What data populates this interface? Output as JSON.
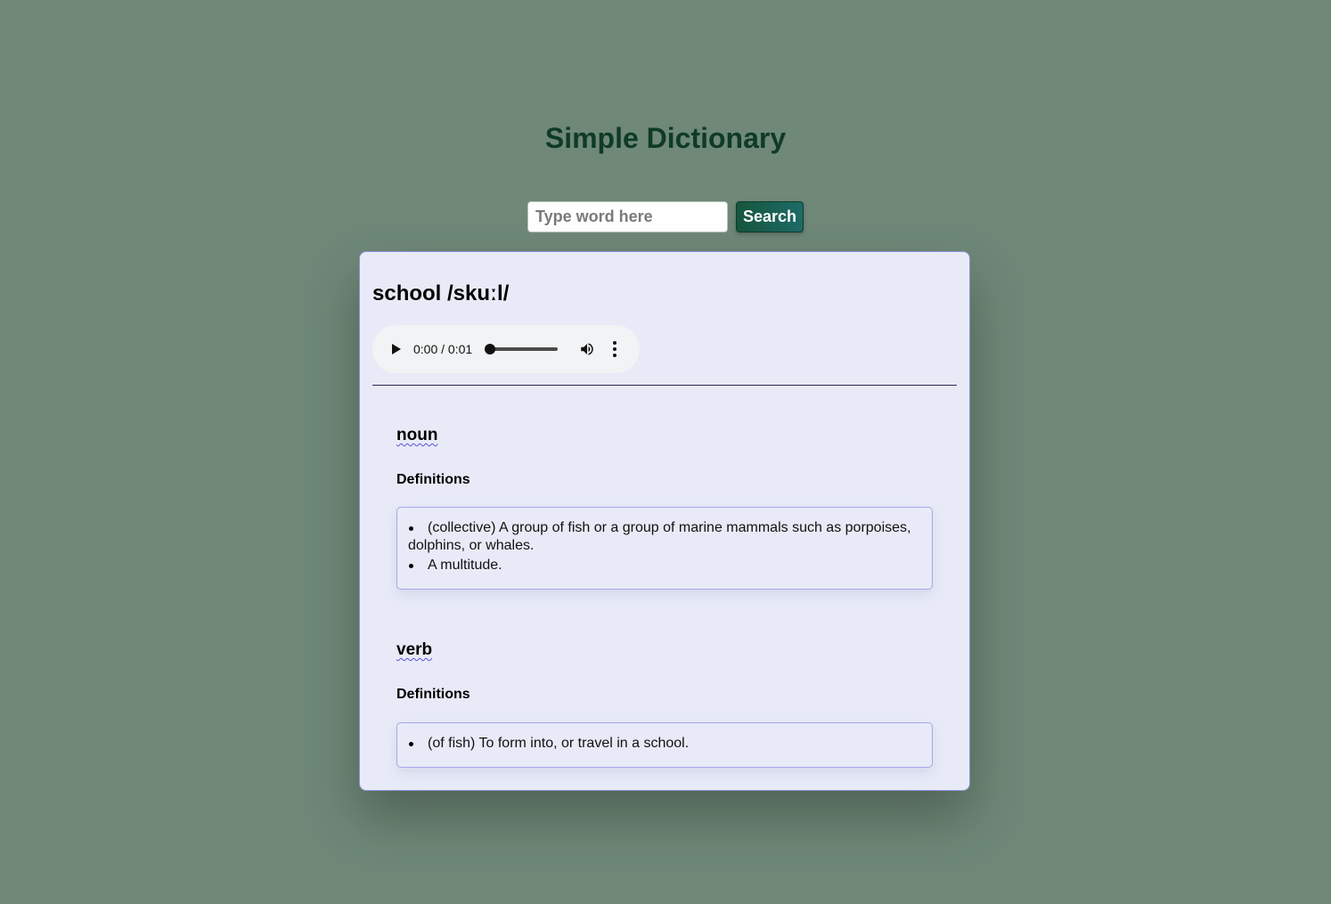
{
  "app": {
    "title": "Simple Dictionary"
  },
  "search": {
    "placeholder": "Type word here",
    "value": "",
    "button_label": "Search"
  },
  "result": {
    "word_heading": "school /skuːl/",
    "audio": {
      "time": "0:00 / 0:01",
      "progress": 0,
      "play_icon": "play-icon",
      "volume_icon": "volume-icon",
      "more_icon": "more-vertical-icon"
    },
    "meanings": [
      {
        "part_of_speech": "noun",
        "definitions_label": "Definitions",
        "definitions": [
          "(collective) A group of fish or a group of marine mammals such as porpoises, dolphins, or whales.",
          "A multitude."
        ]
      },
      {
        "part_of_speech": "verb",
        "definitions_label": "Definitions",
        "definitions": [
          "(of fish) To form into, or travel in a school."
        ]
      }
    ]
  },
  "colors": {
    "background": "#6f8878",
    "title": "#0f3b26",
    "card": "#e8ebf7",
    "card_border": "#8f93d6",
    "accent_underline": "#5b4fd6",
    "button_start": "#17563d",
    "button_end": "#1d6b68"
  }
}
